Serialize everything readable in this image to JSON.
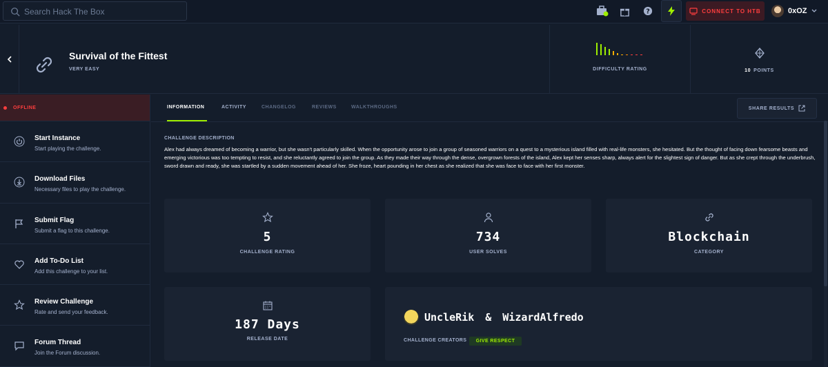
{
  "search": {
    "placeholder": "Search Hack The Box"
  },
  "topbar": {
    "connect_label": "CONNECT TO HTB",
    "username": "0xOZ"
  },
  "challenge": {
    "title": "Survival of the Fittest",
    "difficulty": "VERY EASY",
    "difficulty_label": "DIFFICULTY RATING",
    "points_value": "10",
    "points_label": "POINTS"
  },
  "sidebar": {
    "status": "OFFLINE",
    "items": [
      {
        "title": "Start Instance",
        "desc": "Start playing the challenge."
      },
      {
        "title": "Download Files",
        "desc": "Necessary files to play the challenge."
      },
      {
        "title": "Submit Flag",
        "desc": "Submit a flag to this challenge."
      },
      {
        "title": "Add To-Do List",
        "desc": "Add this challenge to your list."
      },
      {
        "title": "Review Challenge",
        "desc": "Rate and send your feedback."
      },
      {
        "title": "Forum Thread",
        "desc": "Join the Forum discussion."
      }
    ]
  },
  "tabs": {
    "items": [
      "INFORMATION",
      "ACTIVITY",
      "CHANGELOG",
      "REVIEWS",
      "WALKTHROUGHS"
    ],
    "share_label": "SHARE RESULTS"
  },
  "description": {
    "heading": "CHALLENGE DESCRIPTION",
    "text": "Alex had always dreamed of becoming a warrior, but she wasn't particularly skilled. When the opportunity arose to join a group of seasoned warriors on a quest to a mysterious island filled with real-life monsters, she hesitated. But the thought of facing down fearsome beasts and emerging victorious was too tempting to resist, and she reluctantly agreed to join the group. As they made their way through the dense, overgrown forests of the island, Alex kept her senses sharp, always alert for the slightest sign of danger. But as she crept through the underbrush, sword drawn and ready, she was startled by a sudden movement ahead of her. She froze, heart pounding in her chest as she realized that she was face to face with her first monster."
  },
  "stats": {
    "rating_value": "5",
    "rating_label": "CHALLENGE RATING",
    "solves_value": "734",
    "solves_label": "USER SOLVES",
    "category_value": "Blockchain",
    "category_label": "CATEGORY",
    "release_value": "187 Days",
    "release_label": "RELEASE DATE"
  },
  "creators": {
    "first": "UncleRik",
    "separator": "&",
    "second": "WizardAlfredo",
    "label": "CHALLENGE CREATORS",
    "respect_label": "GIVE RESPECT"
  },
  "colors": {
    "accent": "#9fef00",
    "danger": "#ff3e3e",
    "bg": "#141d2b",
    "card": "#1a2332"
  },
  "icons": [
    "search-icon",
    "toolbox-icon",
    "gift-icon",
    "help-icon",
    "bolt-icon",
    "vpn-icon",
    "chevron-down-icon",
    "back-icon",
    "link-icon",
    "diamond-icon",
    "power-icon",
    "download-icon",
    "flag-icon",
    "heart-icon",
    "star-icon",
    "chat-icon",
    "external-link-icon",
    "user-icon",
    "calendar-icon"
  ]
}
